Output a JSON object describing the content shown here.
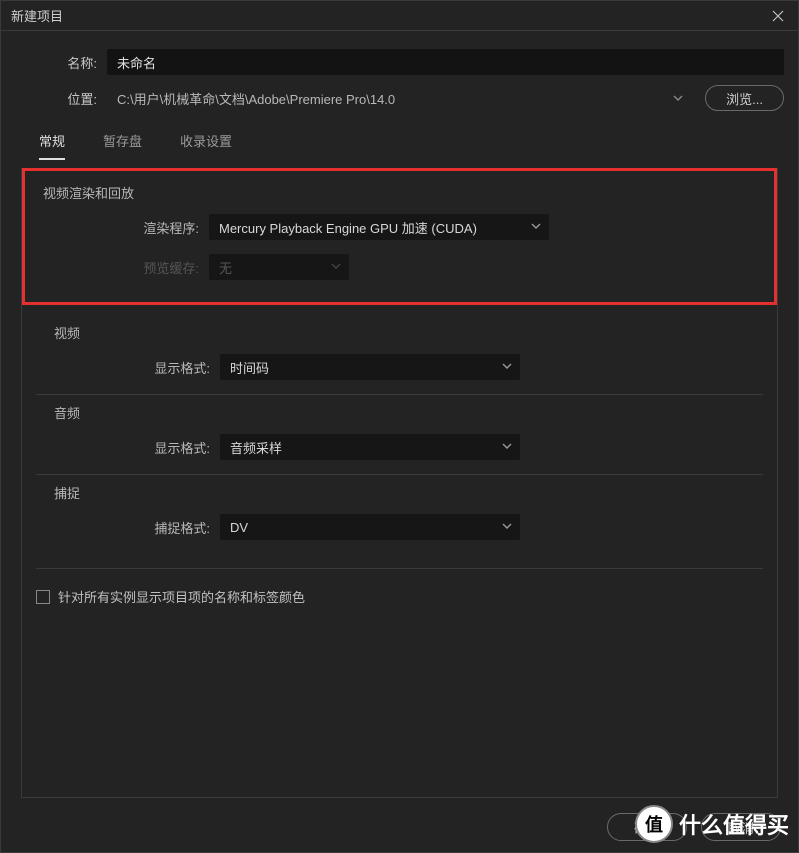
{
  "titlebar": {
    "title": "新建项目"
  },
  "form": {
    "name_label": "名称:",
    "name_value": "未命名",
    "location_label": "位置:",
    "location_value": "C:\\用户\\机械革命\\文档\\Adobe\\Premiere Pro\\14.0",
    "browse": "浏览..."
  },
  "tabs": {
    "general": "常规",
    "scratch": "暂存盘",
    "ingest": "收录设置"
  },
  "sections": {
    "render": {
      "title": "视频渲染和回放",
      "renderer_label": "渲染程序:",
      "renderer_value": "Mercury Playback Engine GPU 加速 (CUDA)",
      "preview_label": "预览缓存:",
      "preview_value": "无"
    },
    "video": {
      "title": "视频",
      "format_label": "显示格式:",
      "format_value": "时间码"
    },
    "audio": {
      "title": "音频",
      "format_label": "显示格式:",
      "format_value": "音频采样"
    },
    "capture": {
      "title": "捕捉",
      "format_label": "捕捉格式:",
      "format_value": "DV"
    }
  },
  "checkbox": {
    "label": "针对所有实例显示项目项的名称和标签颜色"
  },
  "footer": {
    "ok": "确定",
    "cancel": "取消"
  },
  "watermark": {
    "logo": "值",
    "text": "什么值得买"
  }
}
